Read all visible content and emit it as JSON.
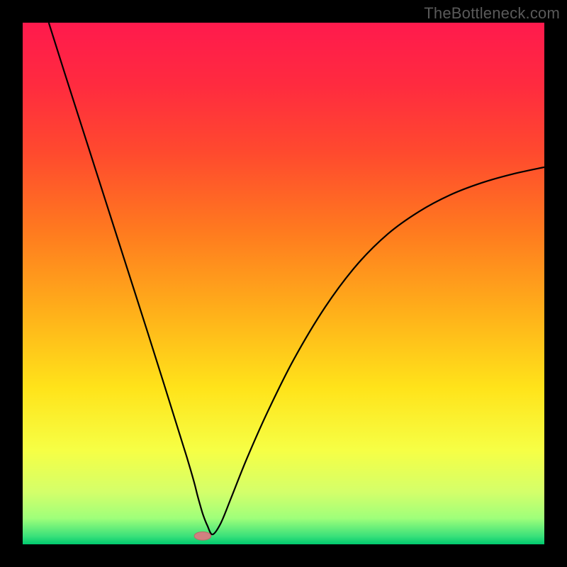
{
  "watermark": "TheBottleneck.com",
  "colors": {
    "frame_bg": "#000000",
    "gradient_stops": [
      {
        "offset": 0.0,
        "color": "#ff1a4d"
      },
      {
        "offset": 0.12,
        "color": "#ff2b3f"
      },
      {
        "offset": 0.25,
        "color": "#ff4a2e"
      },
      {
        "offset": 0.4,
        "color": "#ff7a1f"
      },
      {
        "offset": 0.55,
        "color": "#ffae1a"
      },
      {
        "offset": 0.7,
        "color": "#ffe31a"
      },
      {
        "offset": 0.82,
        "color": "#f6ff45"
      },
      {
        "offset": 0.9,
        "color": "#d4ff6a"
      },
      {
        "offset": 0.95,
        "color": "#9fff7a"
      },
      {
        "offset": 0.985,
        "color": "#38e07a"
      },
      {
        "offset": 1.0,
        "color": "#00c96f"
      }
    ],
    "curve": "#000000",
    "marker_fill": "#d08080",
    "marker_stroke": "#b86a6a"
  },
  "chart_data": {
    "type": "line",
    "title": "",
    "xlabel": "",
    "ylabel": "",
    "xlim": [
      0,
      100
    ],
    "ylim": [
      0,
      100
    ],
    "grid": false,
    "legend": false,
    "series": [
      {
        "name": "curve",
        "x": [
          5,
          8,
          12,
          16,
          20,
          24,
          27,
          29,
          30.5,
          31.5,
          32.3,
          33.0,
          33.5,
          34.0,
          34.6,
          35.4,
          36.4,
          38.0,
          40.0,
          43.0,
          47.0,
          52.0,
          58.0,
          64.0,
          70.0,
          76.0,
          82.0,
          88.0,
          94.0,
          100.0
        ],
        "y": [
          100,
          90.5,
          78.0,
          65.5,
          53.0,
          40.5,
          31.0,
          24.6,
          19.8,
          16.6,
          13.9,
          11.4,
          9.4,
          7.6,
          5.6,
          3.6,
          1.9,
          4.1,
          9.0,
          16.5,
          25.5,
          35.5,
          45.5,
          53.5,
          59.5,
          63.8,
          67.0,
          69.3,
          71.0,
          72.3
        ]
      }
    ],
    "marker": {
      "x": 34.5,
      "y": 1.6,
      "rx": 1.6,
      "ry": 0.8
    }
  }
}
